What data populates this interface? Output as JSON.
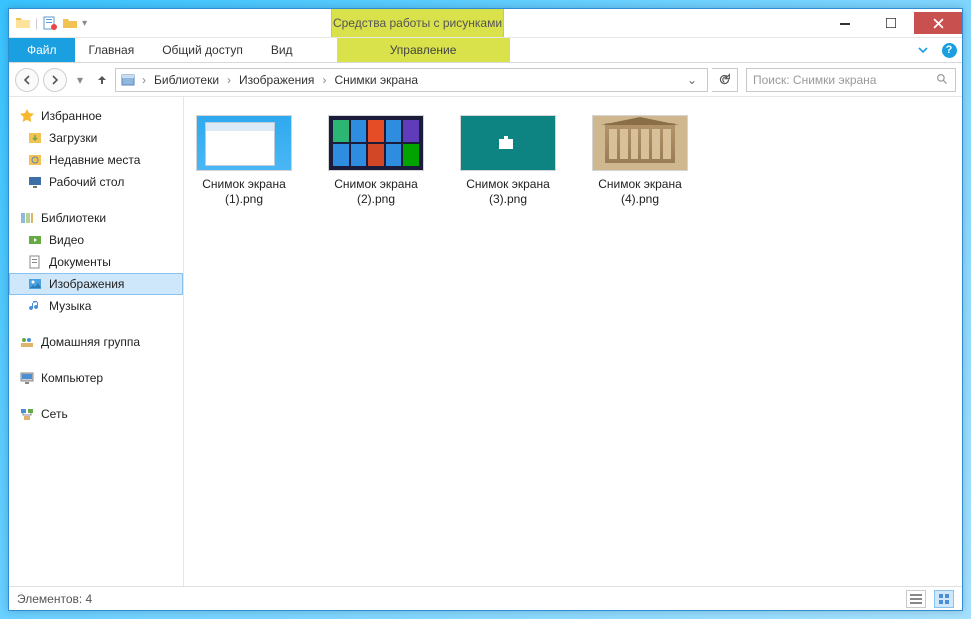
{
  "titlebar": {
    "contextual_tab_caption": "Средства работы с рисунками",
    "window_title": "Снимки экрана"
  },
  "ribbon": {
    "file": "Файл",
    "tabs": [
      "Главная",
      "Общий доступ",
      "Вид"
    ],
    "context_tab": "Управление"
  },
  "nav": {
    "crumbs": [
      "Библиотеки",
      "Изображения",
      "Снимки экрана"
    ],
    "search_placeholder": "Поиск: Снимки экрана"
  },
  "tree": {
    "favorites": {
      "label": "Избранное",
      "items": [
        "Загрузки",
        "Недавние места",
        "Рабочий стол"
      ]
    },
    "libraries": {
      "label": "Библиотеки",
      "items": [
        "Видео",
        "Документы",
        "Изображения",
        "Музыка"
      ],
      "selected": "Изображения"
    },
    "homegroup": {
      "label": "Домашняя группа"
    },
    "computer": {
      "label": "Компьютер"
    },
    "network": {
      "label": "Сеть"
    }
  },
  "files": [
    {
      "name": "Снимок экрана\n(1).png"
    },
    {
      "name": "Снимок экрана\n(2).png"
    },
    {
      "name": "Снимок экрана\n(3).png"
    },
    {
      "name": "Снимок экрана\n(4).png"
    }
  ],
  "status": {
    "text": "Элементов: 4"
  }
}
